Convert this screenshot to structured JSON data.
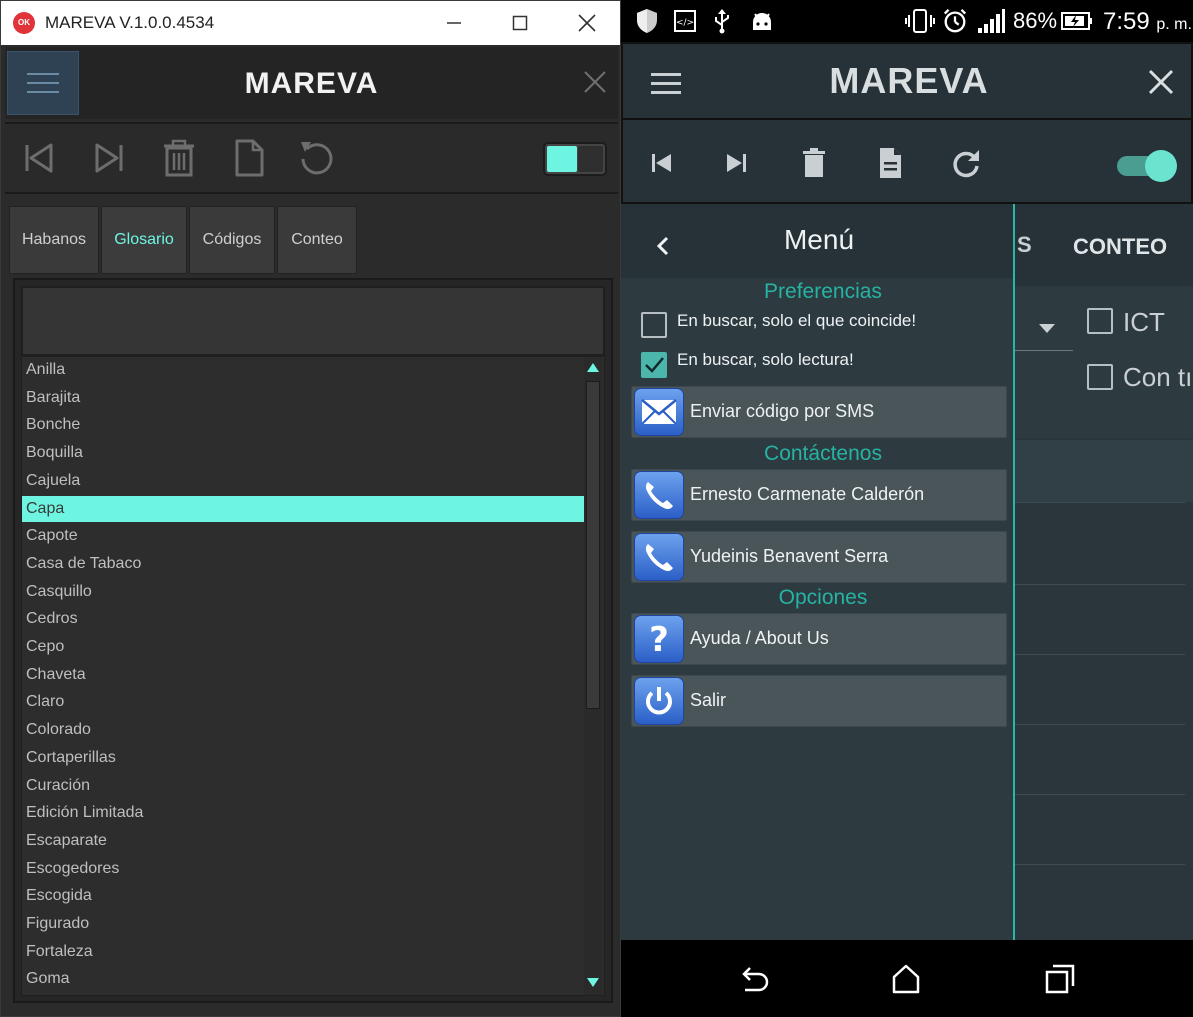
{
  "colors": {
    "accent": "#6ef5e1",
    "mobile_accent": "#26b3a3",
    "win_background": "#2b2b2b",
    "mobile_background": "#263238"
  },
  "desktop": {
    "window": {
      "icon": "app-logo-icon",
      "icon_text": "OK",
      "title": "MAREVA V.1.0.0.4534",
      "controls": [
        "minimize-icon",
        "maximize-icon",
        "close-icon"
      ]
    },
    "header": {
      "app_title": "MAREVA",
      "menu_icon": "hamburger-icon",
      "close_icon": "close-icon"
    },
    "toolbar": {
      "icons": [
        "skip-first-icon",
        "skip-last-icon",
        "trash-icon",
        "document-icon",
        "refresh-icon"
      ],
      "toggle": {
        "state": "on"
      }
    },
    "tabs": [
      {
        "label": "Habanos",
        "active": false
      },
      {
        "label": "Glosario",
        "active": true
      },
      {
        "label": "Códigos",
        "active": false
      },
      {
        "label": "Conteo",
        "active": false
      }
    ],
    "search": {
      "value": ""
    },
    "glossary": {
      "selected": "Capa",
      "items": [
        "Anilla",
        "Barajita",
        "Bonche",
        "Boquilla",
        "Cajuela",
        "Capa",
        "Capote",
        "Casa de Tabaco",
        "Casquillo",
        "Cedros",
        "Cepo",
        "Chaveta",
        "Claro",
        "Colorado",
        "Cortaperillas",
        "Curación",
        "Edición Limitada",
        "Escaparate",
        "Escogedores",
        "Escogida",
        "Figurado",
        "Fortaleza",
        "Goma"
      ]
    }
  },
  "mobile": {
    "status_bar": {
      "left_icons": [
        "shield-icon",
        "developer-icon",
        "usb-icon",
        "android-icon"
      ],
      "right_icons": [
        "vibrate-icon",
        "alarm-icon",
        "signal-icon"
      ],
      "battery": "86%",
      "time": "7:59",
      "ampm": "p. m."
    },
    "header": {
      "app_title": "MAREVA",
      "menu_icon": "hamburger-icon",
      "close_icon": "close-icon"
    },
    "toolbar": {
      "icons": [
        "skip-first-icon",
        "skip-last-icon",
        "trash-icon",
        "document-icon",
        "refresh-icon"
      ],
      "switch": {
        "state": "on"
      }
    },
    "background": {
      "tab_partial": "S",
      "tab_conteo": "CONTEO",
      "check1_label": "ICT",
      "check2_label": "Con tı"
    },
    "drawer": {
      "title": "Menú",
      "back_icon": "chevron-left-icon",
      "sections": {
        "preferencias": "Preferencias",
        "contactenos": "Contáctenos",
        "opciones": "Opciones"
      },
      "preferences": [
        {
          "label": "En buscar, solo el que coincide!",
          "checked": false
        },
        {
          "label": "En buscar, solo lectura!",
          "checked": true
        }
      ],
      "sms": {
        "label": "Enviar código por SMS",
        "icon": "envelope-icon"
      },
      "contacts": [
        {
          "label": "Ernesto Carmenate Calderón",
          "icon": "phone-icon"
        },
        {
          "label": "Yudeinis Benavent Serra",
          "icon": "phone-icon"
        }
      ],
      "options": [
        {
          "label": "Ayuda / About Us",
          "icon": "question-icon"
        },
        {
          "label": "Salir",
          "icon": "power-icon"
        }
      ]
    },
    "nav_bar": {
      "icons": [
        "back-icon",
        "home-icon",
        "recents-icon"
      ]
    }
  }
}
